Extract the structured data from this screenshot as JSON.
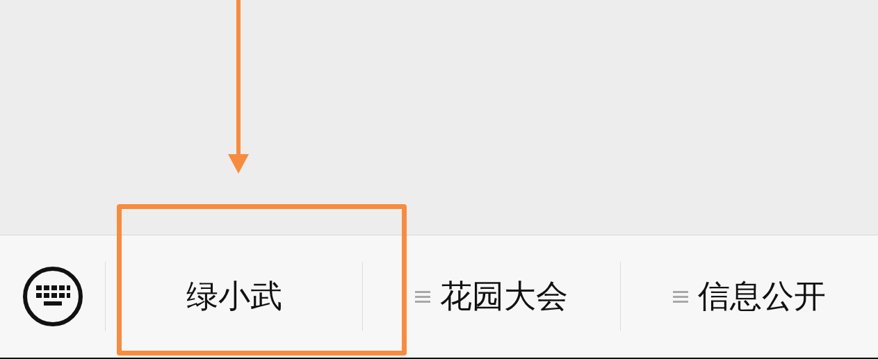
{
  "menu_bar": {
    "items": [
      {
        "label": "绿小武",
        "kind": "plain",
        "highlighted": true
      },
      {
        "label": "花园大会",
        "kind": "submenu",
        "highlighted": false
      },
      {
        "label": "信息公开",
        "kind": "submenu",
        "highlighted": false
      }
    ]
  }
}
